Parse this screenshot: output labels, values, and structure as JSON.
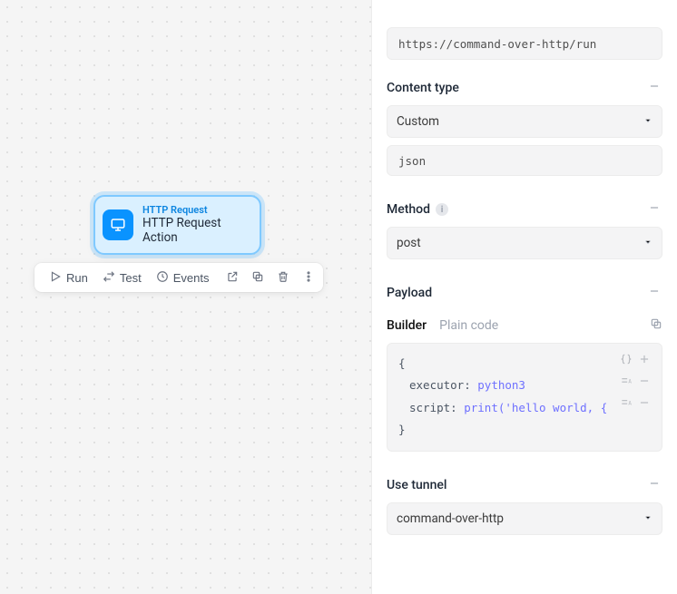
{
  "node": {
    "kicker": "HTTP Request",
    "title": "HTTP Request Action"
  },
  "toolbar": {
    "run": "Run",
    "test": "Test",
    "events": "Events"
  },
  "panel": {
    "url": "https://command-over-http/run",
    "sections": {
      "content_type": {
        "title": "Content type",
        "select_value": "Custom",
        "text_value": "json"
      },
      "method": {
        "title": "Method",
        "select_value": "post"
      },
      "payload": {
        "title": "Payload",
        "tabs": {
          "builder": "Builder",
          "plain": "Plain code"
        },
        "code": {
          "open": "{",
          "close": "}",
          "rows": [
            {
              "key": "executor",
              "value": "python3"
            },
            {
              "key": "script",
              "value": "print('hello world, {"
            }
          ]
        }
      },
      "use_tunnel": {
        "title": "Use tunnel",
        "select_value": "command-over-http"
      }
    }
  }
}
